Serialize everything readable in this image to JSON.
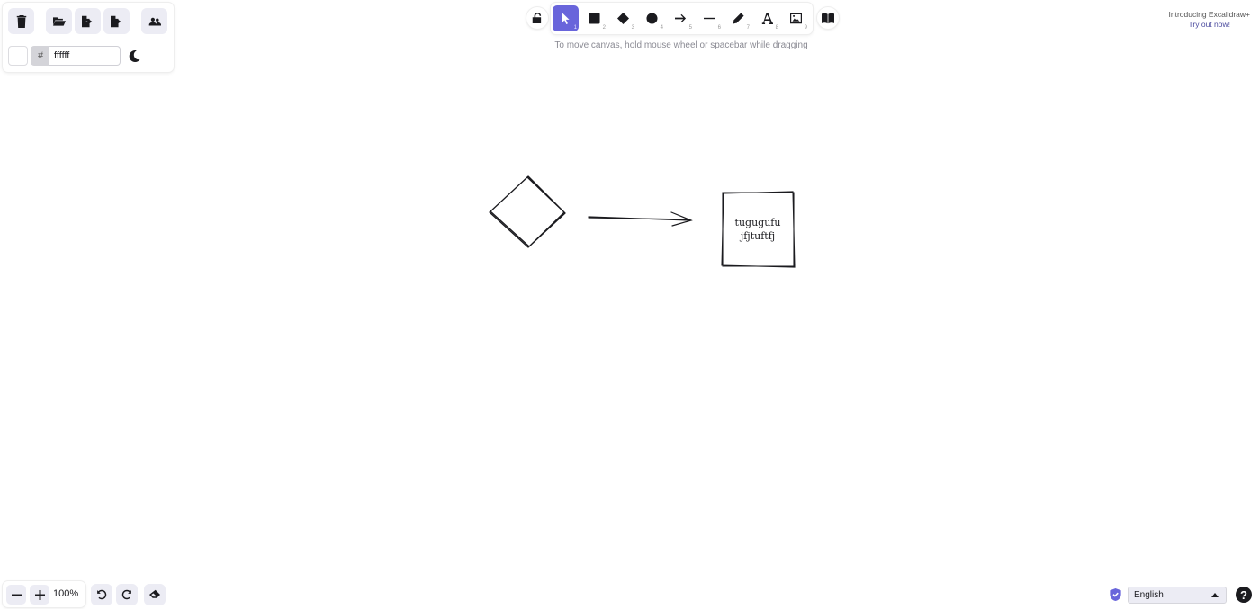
{
  "menu": {
    "buttons": [
      "trash-icon",
      "folder-open-icon",
      "export-icon",
      "export-image-icon",
      "collaborate-icon"
    ],
    "background_label": "#",
    "background_value": "ffffff",
    "theme_icon": "moon-icon"
  },
  "toolbar": {
    "lock_icon": "unlock-icon",
    "tools": [
      {
        "name": "selection",
        "icon": "cursor-icon",
        "shortcut": "1",
        "active": true
      },
      {
        "name": "rectangle",
        "icon": "square-icon",
        "shortcut": "2",
        "active": false
      },
      {
        "name": "diamond",
        "icon": "diamond-icon",
        "shortcut": "3",
        "active": false
      },
      {
        "name": "ellipse",
        "icon": "circle-icon",
        "shortcut": "4",
        "active": false
      },
      {
        "name": "arrow",
        "icon": "arrow-icon",
        "shortcut": "5",
        "active": false
      },
      {
        "name": "line",
        "icon": "line-icon",
        "shortcut": "6",
        "active": false
      },
      {
        "name": "draw",
        "icon": "pencil-icon",
        "shortcut": "7",
        "active": false
      },
      {
        "name": "text",
        "icon": "text-icon",
        "shortcut": "8",
        "active": false
      },
      {
        "name": "image",
        "icon": "image-icon",
        "shortcut": "9",
        "active": false
      }
    ],
    "library_icon": "library-icon",
    "accent": "#6965db"
  },
  "hint": "To move canvas, hold mouse wheel or spacebar while dragging",
  "promo": {
    "line1": "Introducing Excalidraw+",
    "line2": "Try out now!"
  },
  "canvas": {
    "text_line1": "tugugufu",
    "text_line2": "jfjtuftfj"
  },
  "footer": {
    "zoom": "100%",
    "language": "English",
    "help": "?"
  }
}
